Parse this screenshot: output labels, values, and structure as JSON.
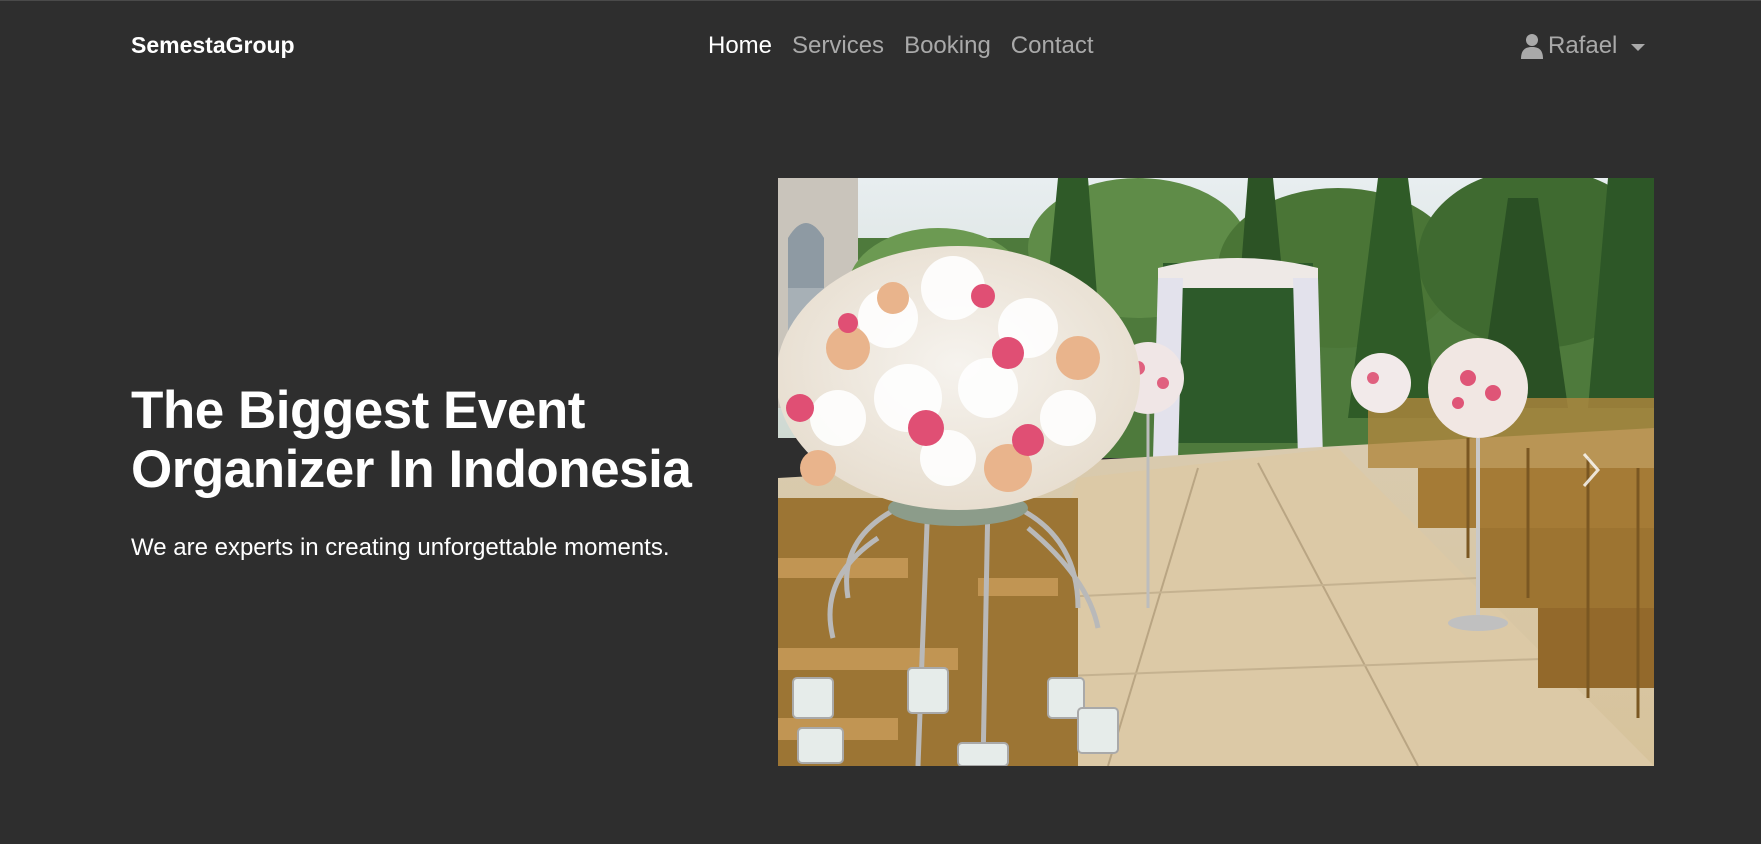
{
  "navbar": {
    "brand": "SemestaGroup",
    "links": [
      {
        "label": "Home",
        "active": true
      },
      {
        "label": "Services",
        "active": false
      },
      {
        "label": "Booking",
        "active": false
      },
      {
        "label": "Contact",
        "active": false
      }
    ],
    "user": {
      "name": "Rafael",
      "icon": "person-icon",
      "dropdown_icon": "caret-down-icon"
    }
  },
  "hero": {
    "title_line1": "The Biggest Event",
    "title_line2": "Organizer In Indonesia",
    "subtitle": "We are experts in creating unforgettable moments."
  },
  "carousel": {
    "image": "wedding-aisle-flowers-photo",
    "next_icon": "chevron-right-icon"
  },
  "colors": {
    "background": "#2e2e2e",
    "text_primary": "#ffffff",
    "text_muted": "#a9a9a9"
  }
}
